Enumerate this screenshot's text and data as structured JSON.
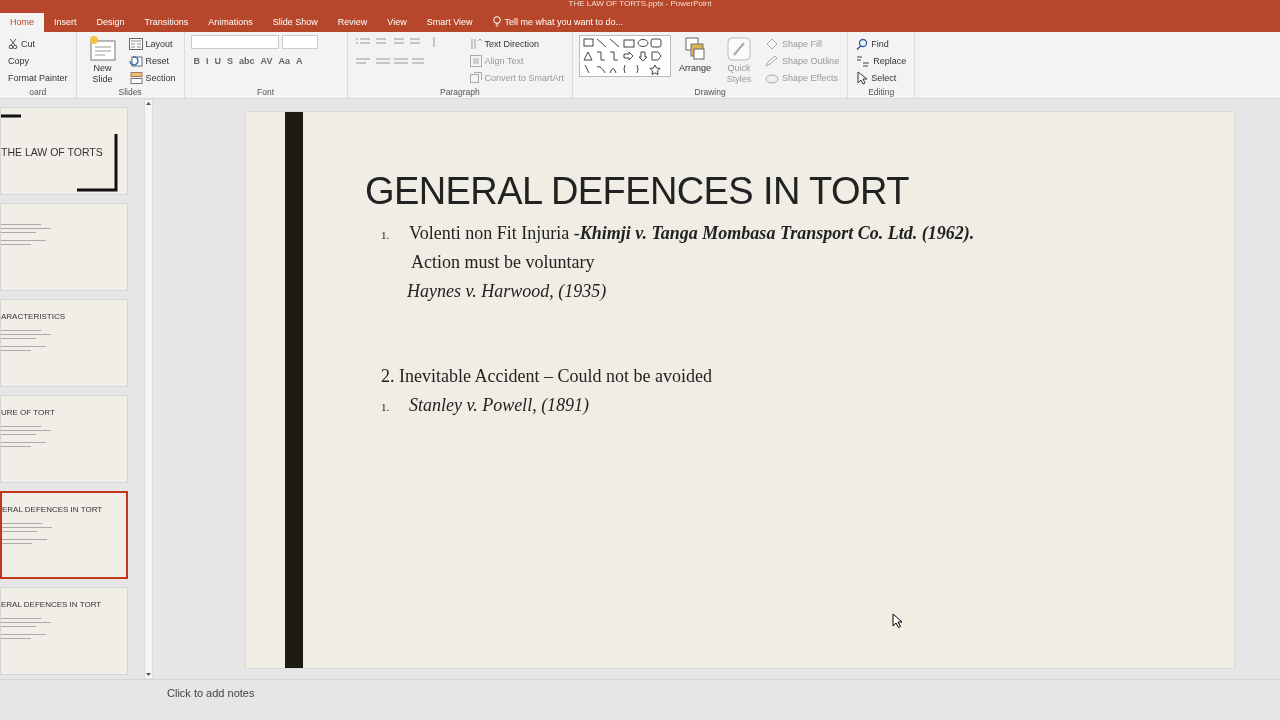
{
  "window": {
    "title": "THE LAW OF TORTS.pptx - PowerPoint"
  },
  "tabs": [
    {
      "label": "Home",
      "selected": true
    },
    {
      "label": "Insert",
      "selected": false
    },
    {
      "label": "Design",
      "selected": false
    },
    {
      "label": "Transitions",
      "selected": false
    },
    {
      "label": "Animations",
      "selected": false
    },
    {
      "label": "Slide Show",
      "selected": false
    },
    {
      "label": "Review",
      "selected": false
    },
    {
      "label": "View",
      "selected": false
    },
    {
      "label": "Smart View",
      "selected": false
    }
  ],
  "tell_me": "Tell me what you want to do...",
  "ribbon": [
    {
      "label": "oard",
      "items": [
        {
          "kind": "small",
          "label": "Cut"
        },
        {
          "kind": "small",
          "label": "Copy"
        },
        {
          "kind": "small",
          "label": "Format Painter"
        }
      ]
    },
    {
      "label": "Slides",
      "items": [
        {
          "kind": "large",
          "label": "New Slide"
        },
        {
          "kind": "small",
          "label": "Layout"
        },
        {
          "kind": "small",
          "label": "Reset"
        },
        {
          "kind": "small",
          "label": "Section"
        }
      ]
    },
    {
      "label": "Font",
      "items": [
        {
          "kind": "fonts"
        },
        {
          "kind": "glyph",
          "label": "B"
        },
        {
          "kind": "glyph",
          "label": "I"
        },
        {
          "kind": "glyph",
          "label": "U"
        },
        {
          "kind": "glyph",
          "label": "S"
        },
        {
          "kind": "glyph",
          "label": "abc"
        },
        {
          "kind": "glyph",
          "label": "AV"
        },
        {
          "kind": "glyph",
          "label": "Aa"
        },
        {
          "kind": "glyph",
          "label": "A"
        }
      ]
    },
    {
      "label": "Paragraph",
      "items": [
        {
          "kind": "paragraph"
        },
        {
          "kind": "small",
          "label": "Text Direction"
        },
        {
          "kind": "small",
          "label": "Align Text"
        },
        {
          "kind": "small",
          "label": "Convert to SmartArt"
        }
      ]
    },
    {
      "label": "Drawing",
      "items": [
        {
          "kind": "shapes"
        },
        {
          "kind": "large",
          "label": "Arrange"
        },
        {
          "kind": "large",
          "label": "Quick Styles"
        },
        {
          "kind": "small",
          "label": "Shape Fill"
        },
        {
          "kind": "small",
          "label": "Shape Outline"
        },
        {
          "kind": "small",
          "label": "Shape Effects"
        }
      ]
    },
    {
      "label": "Editing",
      "items": [
        {
          "kind": "small",
          "label": "Find"
        },
        {
          "kind": "small",
          "label": "Replace"
        },
        {
          "kind": "small",
          "label": "Select"
        }
      ]
    }
  ],
  "thumbnails": [
    {
      "title": "THE LAW OF TORTS",
      "kind": "cover",
      "selected": false
    },
    {
      "kind": "text",
      "selected": false
    },
    {
      "title": "ARACTERISTICS",
      "kind": "text",
      "selected": false
    },
    {
      "title": "URE OF TORT",
      "kind": "text",
      "selected": false
    },
    {
      "title": "ERAL DEFENCES IN TORT",
      "kind": "text",
      "selected": true
    },
    {
      "title": "ERAL DEFENCES IN TORT",
      "kind": "text",
      "selected": false
    }
  ],
  "slide": {
    "title": "GENERAL DEFENCES IN TORT",
    "lines": [
      {
        "kind": "numbered",
        "marker": "1.",
        "text": "Volenti non Fit Injuria -**Khimji v. Tanga Mombasa Transport Co. Ltd. (1962).**",
        "italic": false
      },
      {
        "kind": "continuation",
        "text": "Action must be voluntary",
        "italic": false
      },
      {
        "kind": "case",
        "text": "Haynes v. Harwood, (1935)",
        "italic": true
      },
      {
        "kind": "gap"
      },
      {
        "kind": "plain",
        "text": "2. Inevitable Accident – Could not be avoided",
        "italic": false
      },
      {
        "kind": "numbered",
        "marker": "1.",
        "text": "Stanley v. Powell, (1891)",
        "italic": true
      }
    ]
  },
  "notes_placeholder": "Click to add notes"
}
